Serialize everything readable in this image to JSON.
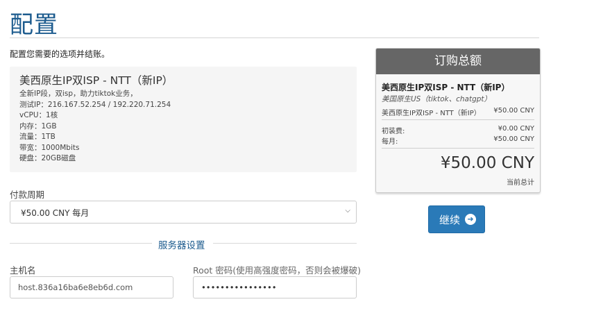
{
  "page": {
    "title": "配置",
    "intro": "配置您需要的选项并结账。"
  },
  "product": {
    "name": "美西原生IP双ISP - NTT（新IP）",
    "description": [
      "全新IP段，双isp，助力tiktok业务，",
      "测试IP：216.167.52.254 / 192.220.71.254",
      "vCPU：1核",
      "内存：1GB",
      "流量：1TB",
      "带宽：1000Mbits",
      "硬盘：20GB磁盘"
    ]
  },
  "billing": {
    "label": "付款周期",
    "selected": "¥50.00 CNY 每月"
  },
  "server_config": {
    "section_title": "服务器设置",
    "hostname_label": "主机名",
    "hostname_value": "host.836a16ba6e8eb6d.com",
    "password_label": "Root 密码(使用高强度密码，否则会被爆破)",
    "password_value": "••••••••••••••••"
  },
  "summary": {
    "title": "订购总额",
    "product_name": "美西原生IP双ISP - NTT（新IP）",
    "product_group": "美国原生US（tiktok、chatgpt）",
    "line_item_label": "美西原生IP双ISP - NTT（新IP）",
    "line_item_price": "¥50.00 CNY",
    "setup_fee_label": "初装费:",
    "setup_fee_value": "¥0.00 CNY",
    "monthly_label": "每月:",
    "monthly_value": "¥50.00 CNY",
    "total": "¥50.00 CNY",
    "total_label": "当前总计"
  },
  "actions": {
    "continue_label": "继续",
    "continue_icon": "arrow-circle-right-icon"
  }
}
